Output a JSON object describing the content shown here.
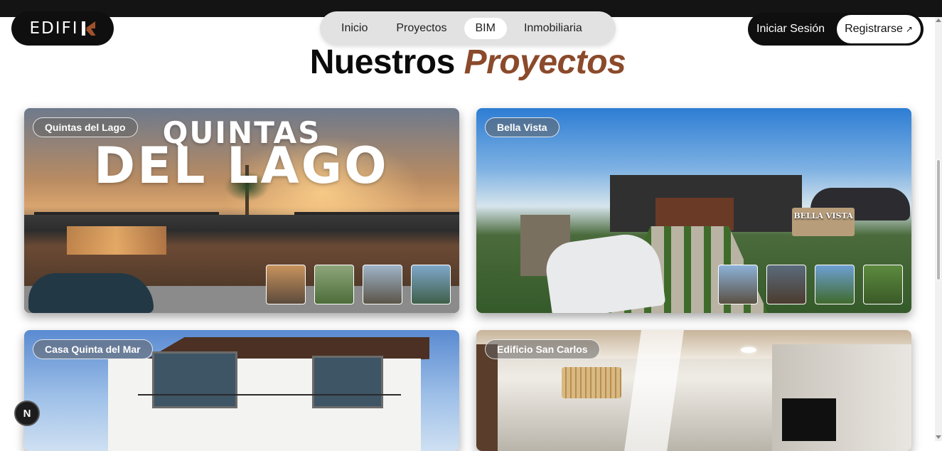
{
  "brand": {
    "name": "EDIFI",
    "accent": "#a0522d"
  },
  "nav": {
    "items": [
      {
        "label": "Inicio",
        "active": false
      },
      {
        "label": "Proyectos",
        "active": false
      },
      {
        "label": "BIM",
        "active": true
      },
      {
        "label": "Inmobiliaria",
        "active": false
      }
    ]
  },
  "auth": {
    "login_label": "Iniciar Sesión",
    "register_label": "Registrarse",
    "register_icon": "arrow-up-right-icon"
  },
  "section": {
    "title_main": "Nuestros",
    "title_accent": "Proyectos",
    "accent_color": "#8b4a2b"
  },
  "projects": [
    {
      "name": "Quintas del Lago",
      "hero_line1": "QUINTAS",
      "hero_line2": "DEL LAGO",
      "thumb_count": 4
    },
    {
      "name": "Bella Vista",
      "sign_text": "BELLA VISTA",
      "thumb_count": 4
    },
    {
      "name": "Casa Quinta del Mar"
    },
    {
      "name": "Edificio San Carlos"
    }
  ],
  "fab": {
    "label": "N"
  }
}
